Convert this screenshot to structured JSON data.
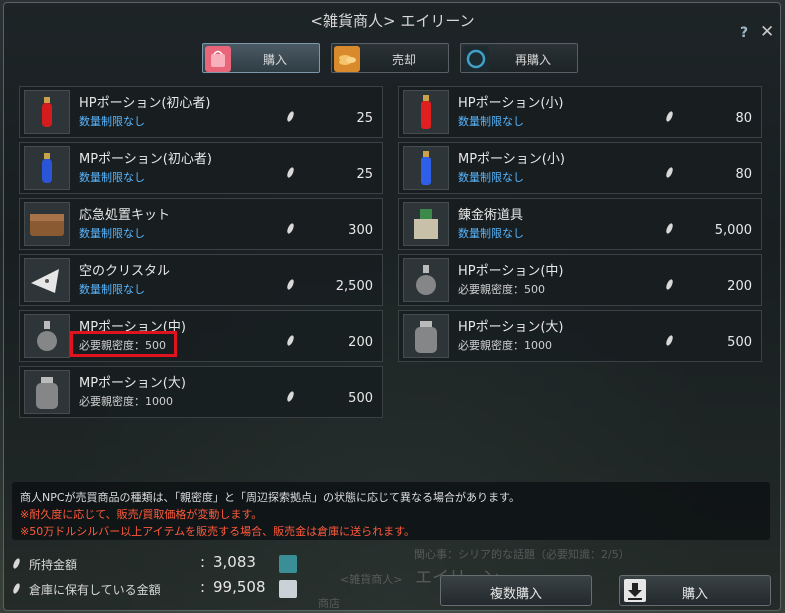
{
  "window": {
    "title": "<雑貨商人> エイリーン",
    "help": "?",
    "close": "✕"
  },
  "tabs": [
    {
      "label": "購入",
      "icon": "bag-icon",
      "color": "#e8657a"
    },
    {
      "label": "売却",
      "icon": "coins-icon",
      "color": "#d98a2a"
    },
    {
      "label": "再購入",
      "icon": "refresh-icon",
      "color": "#3fa0c8"
    }
  ],
  "items": [
    {
      "name": "HPポーション(初心者)",
      "cond": "数量制限なし",
      "price": "25",
      "icon": "red-potion-icon"
    },
    {
      "name": "HPポーション(小)",
      "cond": "数量制限なし",
      "price": "80",
      "icon": "red-potion-icon"
    },
    {
      "name": "MPポーション(初心者)",
      "cond": "数量制限なし",
      "price": "25",
      "icon": "blue-potion-icon"
    },
    {
      "name": "MPポーション(小)",
      "cond": "数量制限なし",
      "price": "80",
      "icon": "blue-potion-icon"
    },
    {
      "name": "応急処置キット",
      "cond": "数量制限なし",
      "price": "300",
      "icon": "chest-icon"
    },
    {
      "name": "錬金術道具",
      "cond": "数量制限なし",
      "price": "5,000",
      "icon": "alchemy-tool-icon"
    },
    {
      "name": "空のクリスタル",
      "cond": "数量制限なし",
      "price": "2,500",
      "icon": "crystal-icon"
    },
    {
      "name": "HPポーション(中)",
      "cond": "必要親密度：500",
      "price": "200",
      "icon": "empty-flask-icon"
    },
    {
      "name": "MPポーション(中)",
      "cond": "必要親密度：500",
      "price": "200",
      "icon": "empty-flask-icon"
    },
    {
      "name": "HPポーション(大)",
      "cond": "必要親密度：1000",
      "price": "500",
      "icon": "empty-jar-icon"
    },
    {
      "name": "MPポーション(大)",
      "cond": "必要親密度：1000",
      "price": "500",
      "icon": "empty-jar-icon"
    }
  ],
  "notice": {
    "line1": "商人NPCが売買商品の種類は、「親密度」と「周辺探索拠点」の状態に応じて異なる場合があります。",
    "line2": "※耐久度に応じて、販売/買取価格が変動します。",
    "line3": "※50万ドルシルバー以上アイテムを販売する場合、販売金は倉庫に送られます。"
  },
  "background_text": {
    "t1": "関心事：シリア的な話題（必要知識：2/5）",
    "t2": "<雑貨商人>",
    "t3": "エイリーン",
    "t4": "商店"
  },
  "money": {
    "held_label": "所持金額",
    "held_value": "3,083",
    "storage_label": "倉庫に保有している金額",
    "storage_value": "99,508",
    "colon": ":"
  },
  "buttons": {
    "multi_buy": "複数購入",
    "buy": "購入"
  }
}
